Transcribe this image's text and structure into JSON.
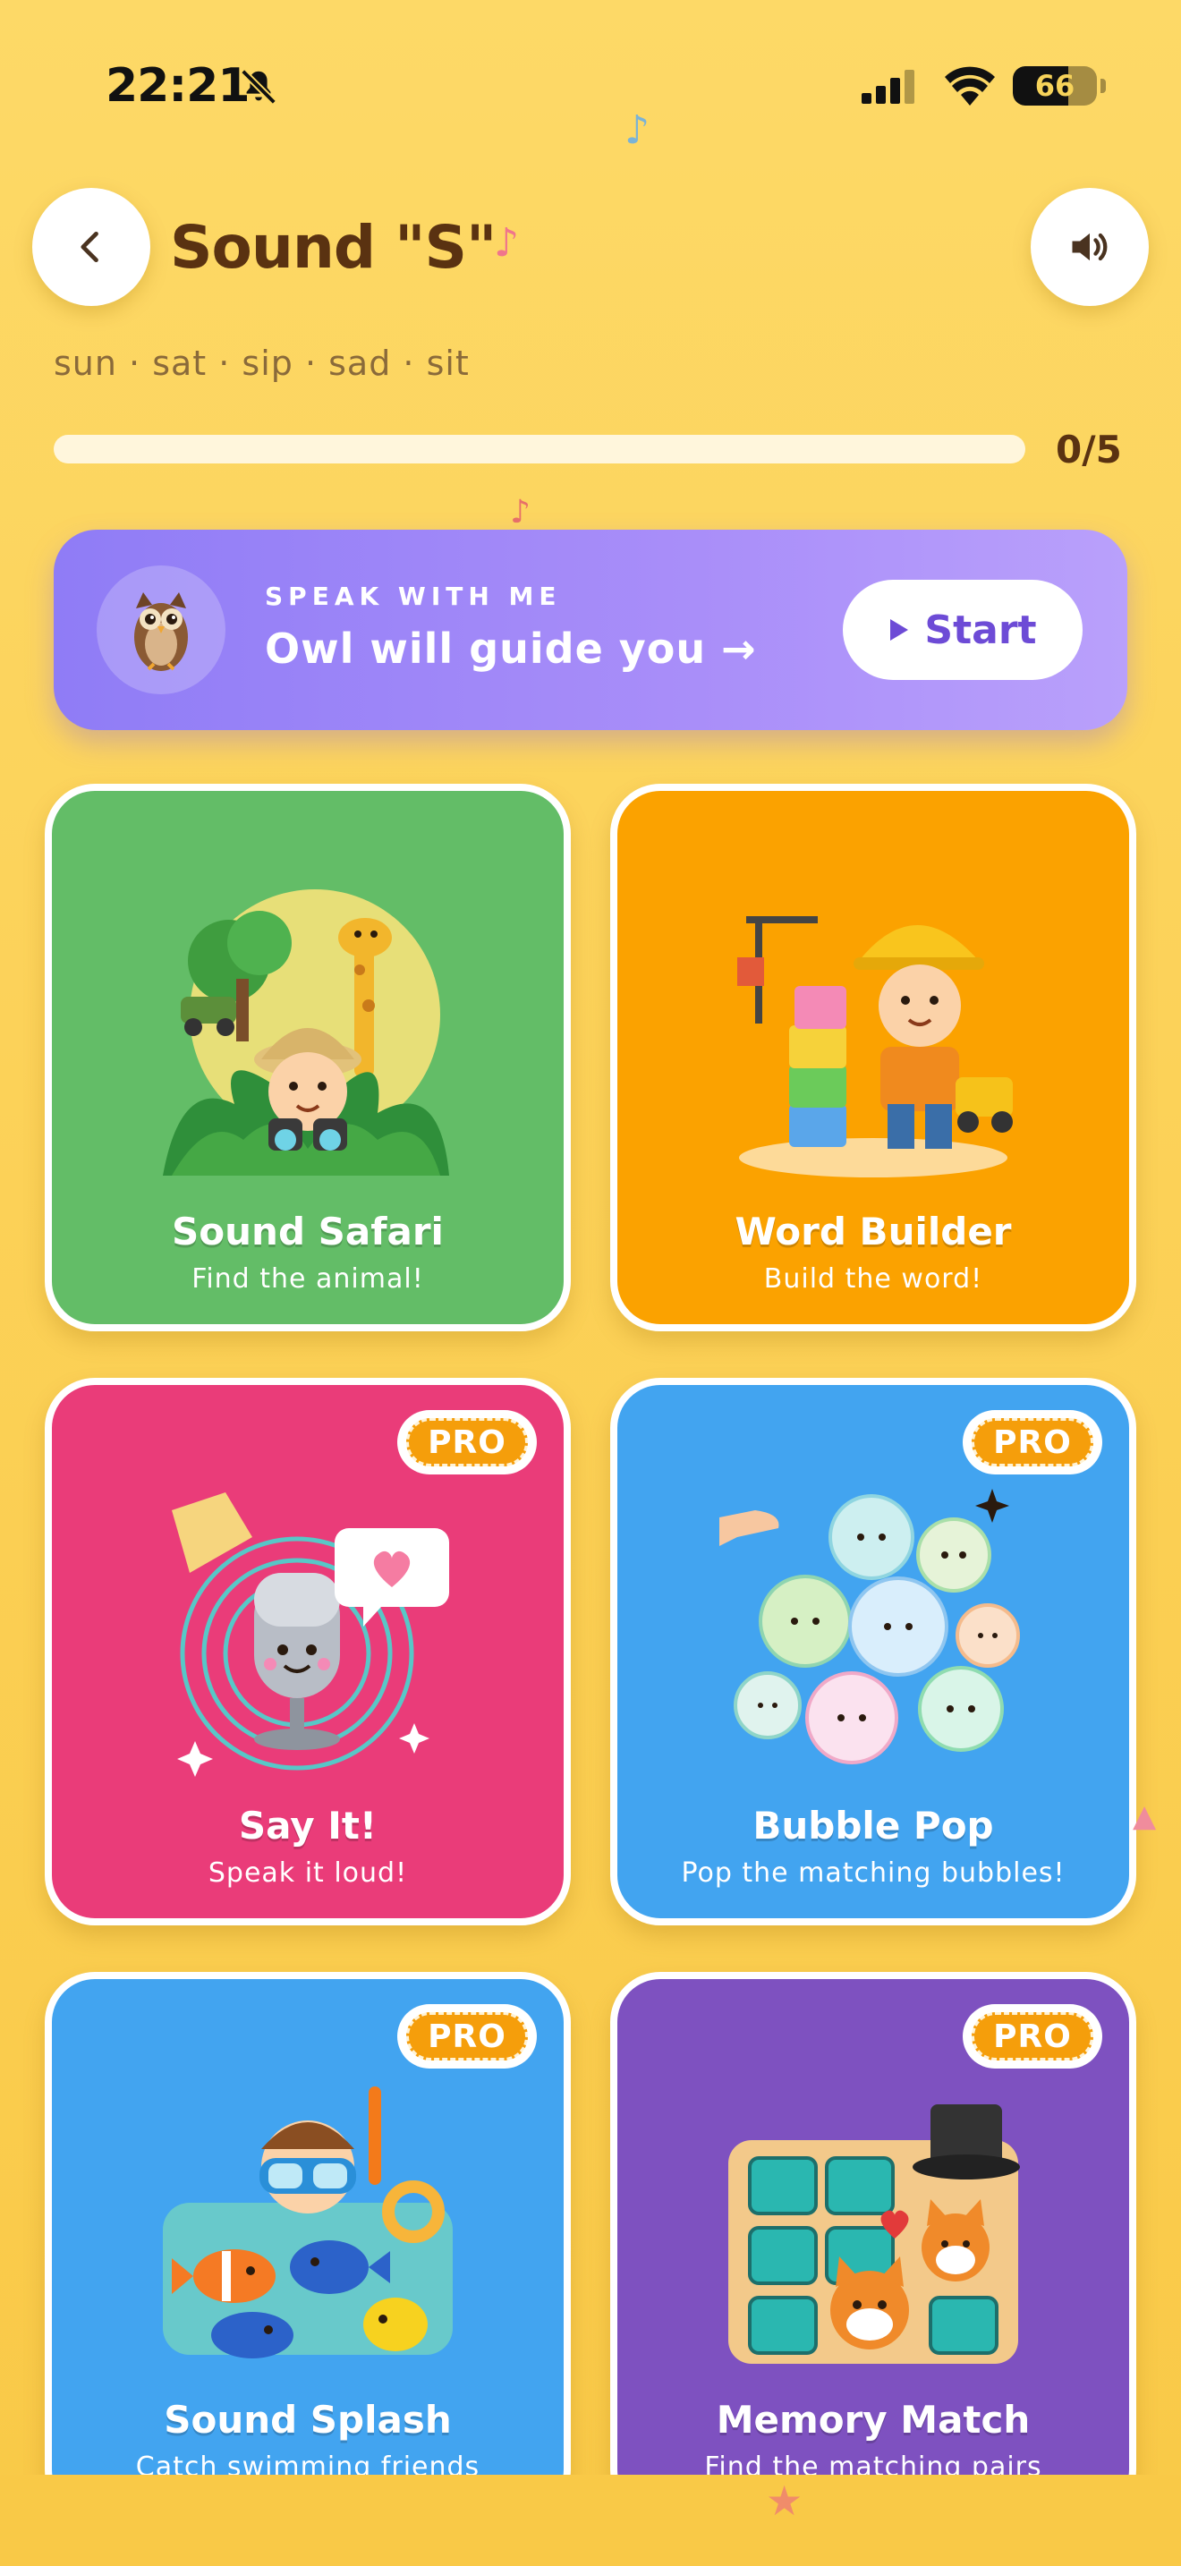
{
  "status_bar": {
    "time": "22:21",
    "battery": "66",
    "battery_level": 0.66
  },
  "header": {
    "title": "Sound \"S\"",
    "words": "sun · sat · sip · sad · sit"
  },
  "progress": {
    "text": "0/5",
    "value": 0,
    "total": 5
  },
  "banner": {
    "eyebrow": "SPEAK WITH ME",
    "title": "Owl will guide you →",
    "start_label": "Start"
  },
  "cards": [
    {
      "title": "Sound Safari",
      "subtitle": "Find the animal!",
      "color": "#63bd67",
      "pro": false
    },
    {
      "title": "Word Builder",
      "subtitle": "Build the word!",
      "color": "#fba200",
      "pro": false
    },
    {
      "title": "Say It!",
      "subtitle": "Speak it loud!",
      "color": "#ea3c79",
      "pro": true,
      "pro_label": "PRO"
    },
    {
      "title": "Bubble Pop",
      "subtitle": "Pop the matching bubbles!",
      "color": "#42a4f0",
      "pro": true,
      "pro_label": "PRO"
    },
    {
      "title": "Sound Splash",
      "subtitle": "Catch swimming friends",
      "color": "#42a4f0",
      "pro": true,
      "pro_label": "PRO"
    },
    {
      "title": "Memory Match",
      "subtitle": "Find the matching pairs",
      "color": "#7e51c0",
      "pro": true,
      "pro_label": "PRO"
    }
  ],
  "icons": {
    "back": "chevron-left-icon",
    "sound": "speaker-icon",
    "owl": "owl-icon",
    "play": "play-icon",
    "mute": "bell-slash-icon"
  }
}
